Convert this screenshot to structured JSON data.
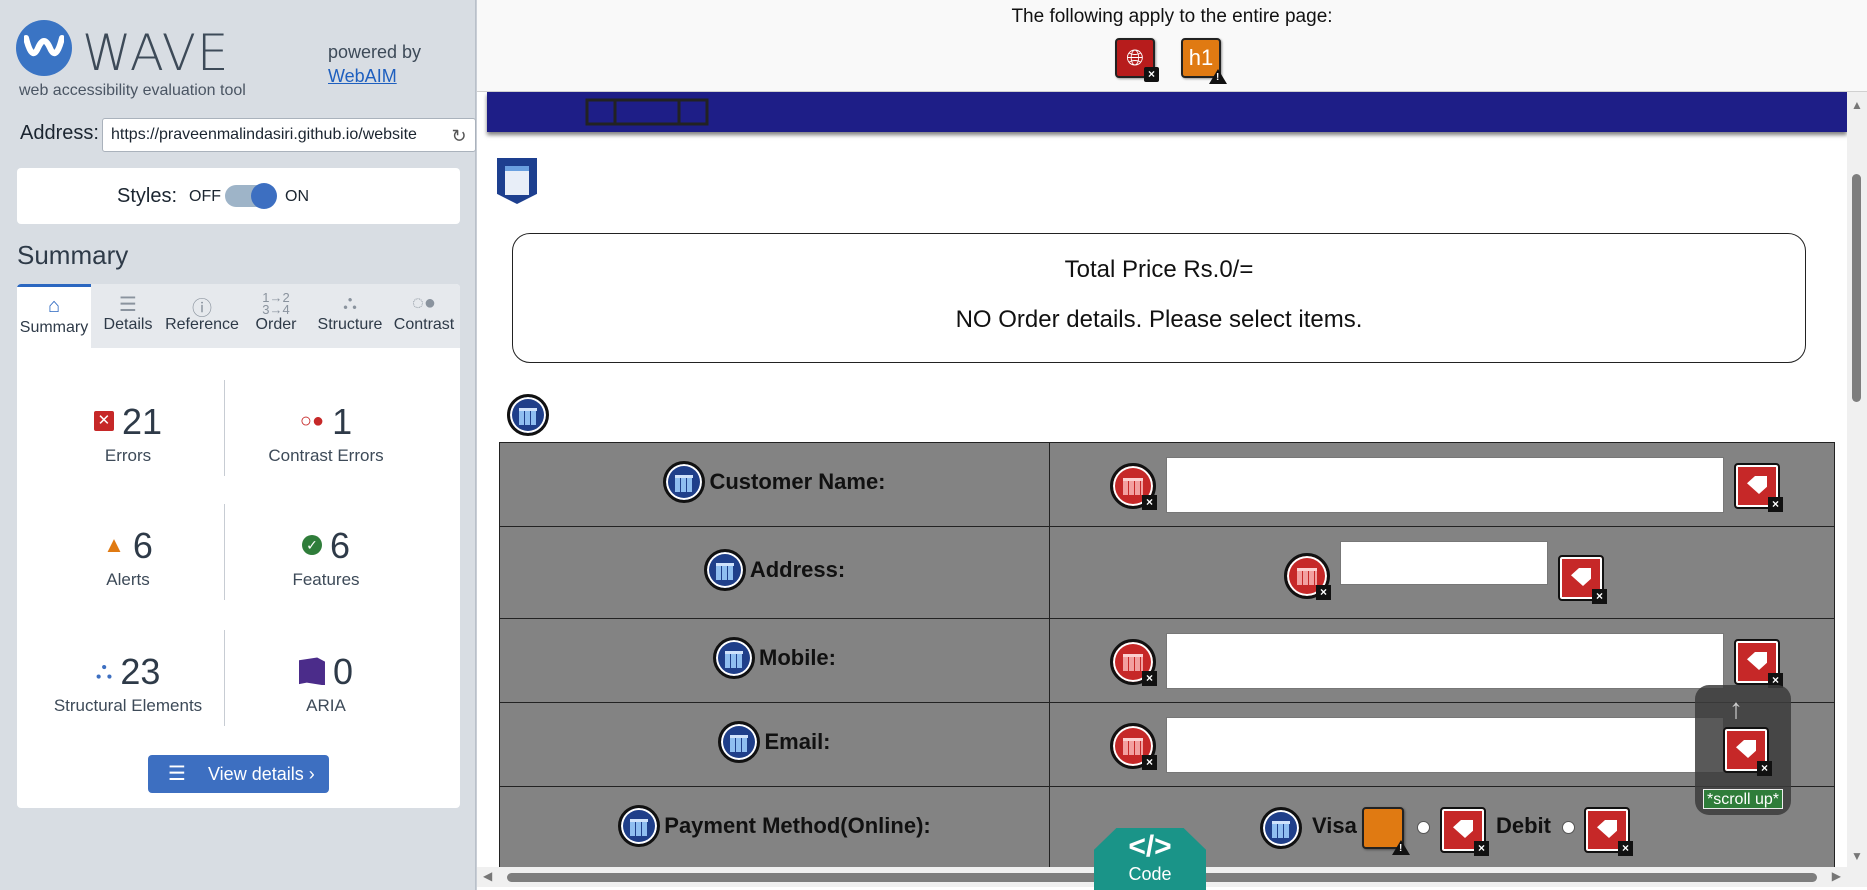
{
  "sidebar": {
    "logo_word": "WAVE",
    "logo_sub": "web accessibility evaluation tool",
    "powered_by": "powered by",
    "powered_link": "WebAIM",
    "address_label": "Address:",
    "address_value": "https://praveenmalindasiri.github.io/website",
    "styles_label": "Styles:",
    "styles_off": "OFF",
    "styles_on": "ON",
    "styles_enabled": true,
    "summary_heading": "Summary",
    "tabs": [
      {
        "label": "Summary",
        "icon": "home-icon"
      },
      {
        "label": "Details",
        "icon": "list-icon"
      },
      {
        "label": "Reference",
        "icon": "info-icon"
      },
      {
        "label": "Order",
        "icon": "order-icon"
      },
      {
        "label": "Structure",
        "icon": "structure-icon"
      },
      {
        "label": "Contrast",
        "icon": "contrast-icon"
      }
    ],
    "active_tab": "Summary",
    "stats": {
      "errors": {
        "count": "21",
        "label": "Errors"
      },
      "contrast_errors": {
        "count": "1",
        "label": "Contrast Errors"
      },
      "alerts": {
        "count": "6",
        "label": "Alerts"
      },
      "features": {
        "count": "6",
        "label": "Features"
      },
      "structural": {
        "count": "23",
        "label": "Structural Elements"
      },
      "aria": {
        "count": "0",
        "label": "ARIA"
      }
    },
    "view_details": "View details ›"
  },
  "main": {
    "banner_text": "The following apply to the entire page:",
    "banner_icons": [
      "language-error-icon",
      "h1-alert-icon"
    ],
    "h1_glyph": "h1",
    "total_price": "Total Price Rs.0/=",
    "order_details": "NO Order details. Please select items.",
    "form_rows": [
      {
        "label": "Customer Name:"
      },
      {
        "label": "Address:"
      },
      {
        "label": "Mobile:"
      },
      {
        "label": "Email:"
      },
      {
        "label": "Payment Method(Online):"
      }
    ],
    "payment_options": [
      "Visa",
      "Debit"
    ],
    "scroll_up": "*scroll up*",
    "code_glyph": "</>",
    "code_label": "Code"
  },
  "colors": {
    "accent": "#3d6fc1",
    "error": "#c62828",
    "alert": "#e07a12",
    "feature": "#2f7d3a",
    "nav_strip": "#1e1e87",
    "table_bg": "#838383",
    "code_tab": "#1a9488"
  }
}
